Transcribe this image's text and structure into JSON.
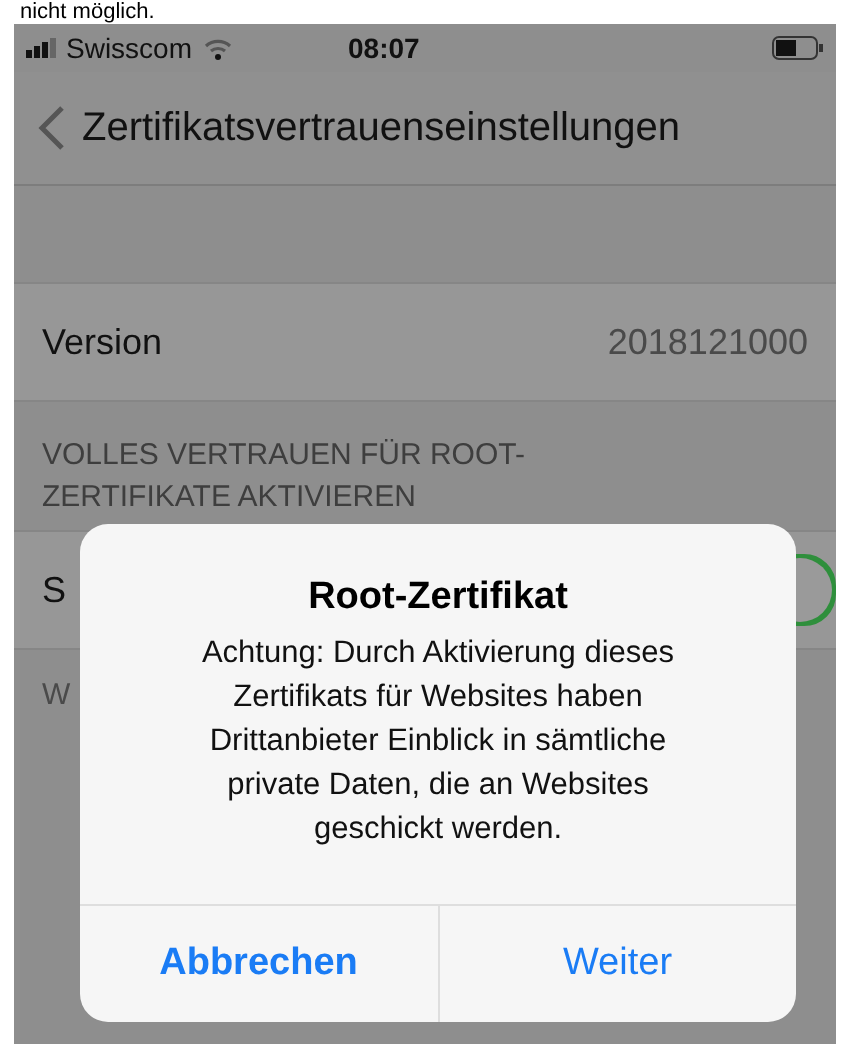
{
  "caption": "nicht möglich.",
  "status_bar": {
    "carrier": "Swisscom",
    "time": "08:07"
  },
  "nav": {
    "title": "Zertifikatsvertrauenseinstellungen"
  },
  "version_row": {
    "label": "Version",
    "value": "2018121000"
  },
  "section_header": "VOLLES VERTRAUEN FÜR ROOT-ZERTIFIKATE AKTIVIEREN",
  "switch_row": {
    "label": "S",
    "on": true
  },
  "footer": "W",
  "alert": {
    "title": "Root-Zertifikat",
    "message": "Achtung: Durch Aktivierung dieses Zertifikats für Websites haben Drittanbieter Einblick in sämtliche private Daten, die an Websites geschickt werden.",
    "buttons": [
      {
        "label": "Abbrechen",
        "kind": "cancel"
      },
      {
        "label": "Weiter",
        "kind": "default"
      }
    ]
  }
}
